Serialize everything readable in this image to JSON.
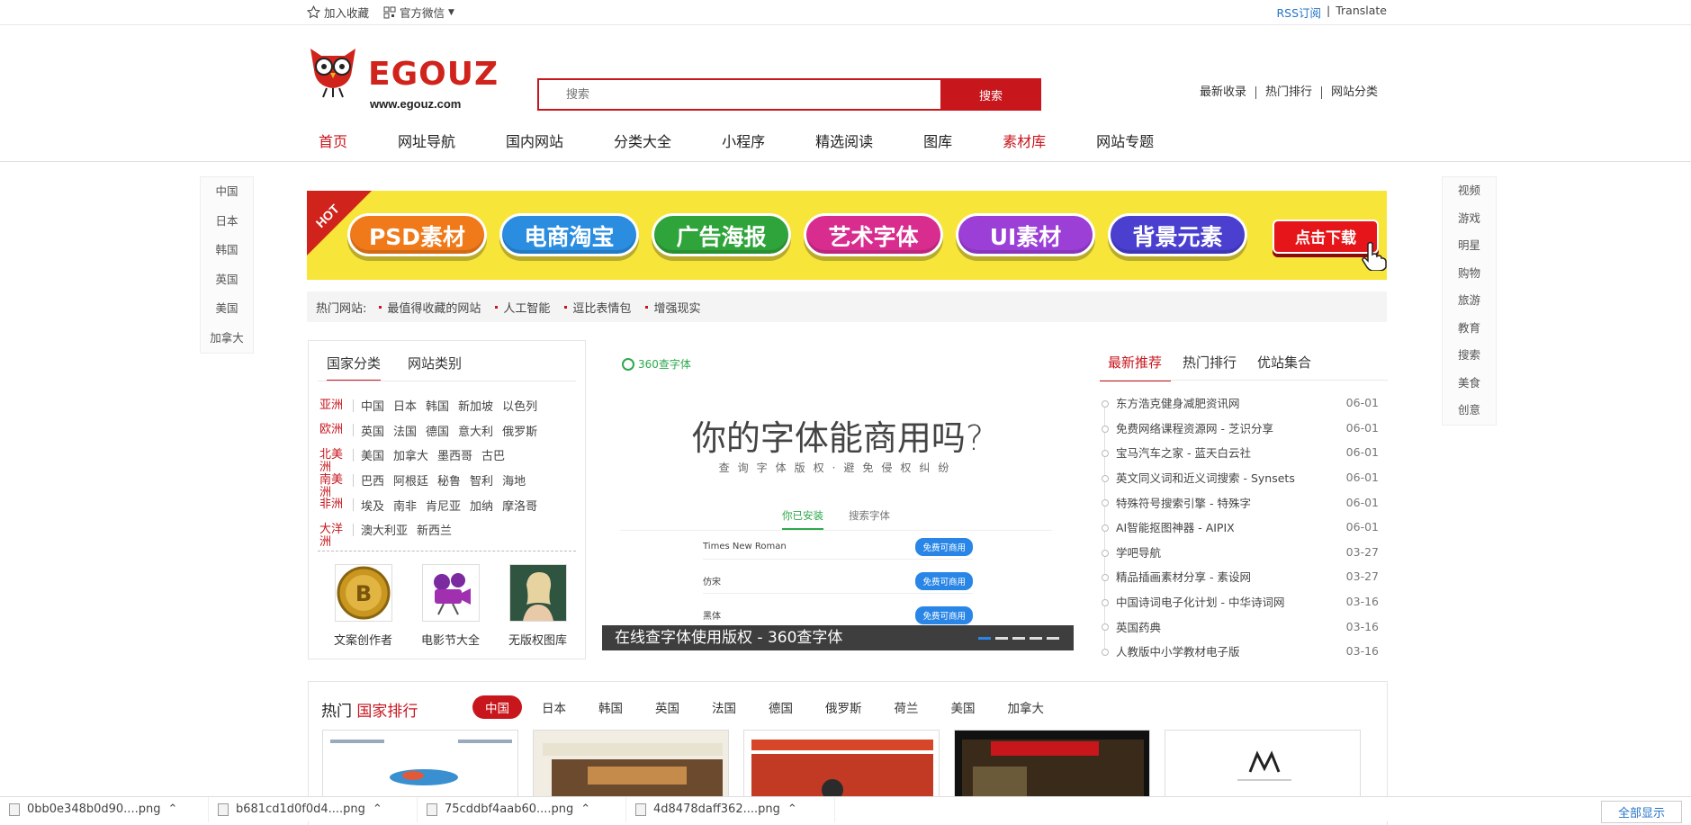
{
  "topbar": {
    "bookmark": "加入收藏",
    "wechat": "官方微信",
    "rss": "RSS订阅",
    "sep": "|",
    "translate": "Translate"
  },
  "logo": {
    "wordmark": "EGOUZ",
    "url": "www.egouz.com"
  },
  "search": {
    "placeholder": "搜索",
    "button": "搜索"
  },
  "header_links": [
    "最新收录",
    "热门排行",
    "网站分类"
  ],
  "nav": [
    "首页",
    "网址导航",
    "国内网站",
    "分类大全",
    "小程序",
    "精选阅读",
    "图库",
    "素材库",
    "网站专题"
  ],
  "side_left": [
    "中国",
    "日本",
    "韩国",
    "英国",
    "美国",
    "加拿大"
  ],
  "side_right": [
    "视频",
    "游戏",
    "明星",
    "购物",
    "旅游",
    "教育",
    "搜索",
    "美食",
    "创意"
  ],
  "banner": {
    "hot": "HOT",
    "pills": [
      {
        "label": "PSD素材",
        "color": "#f07a1a"
      },
      {
        "label": "电商淘宝",
        "color": "#2a8de0"
      },
      {
        "label": "广告海报",
        "color": "#2fa43a"
      },
      {
        "label": "艺术字体",
        "color": "#d82c8e"
      },
      {
        "label": "UI素材",
        "color": "#9b3fd6"
      },
      {
        "label": "背景元素",
        "color": "#4a3fcf"
      }
    ],
    "download": "点击下载"
  },
  "hot_sites": {
    "label": "热门网站:",
    "items": [
      "最值得收藏的网站",
      "人工智能",
      "逗比表情包",
      "增强现实"
    ]
  },
  "country_panel": {
    "tabs": [
      "国家分类",
      "网站类别"
    ],
    "regions": [
      {
        "name": "亚洲",
        "countries": [
          "中国",
          "日本",
          "韩国",
          "新加坡",
          "以色列"
        ]
      },
      {
        "name": "欧洲",
        "countries": [
          "英国",
          "法国",
          "德国",
          "意大利",
          "俄罗斯"
        ]
      },
      {
        "name": "北美洲",
        "countries": [
          "美国",
          "加拿大",
          "墨西哥",
          "古巴"
        ]
      },
      {
        "name": "南美洲",
        "countries": [
          "巴西",
          "阿根廷",
          "秘鲁",
          "智利",
          "海地"
        ]
      },
      {
        "name": "非洲",
        "countries": [
          "埃及",
          "南非",
          "肯尼亚",
          "加纳",
          "摩洛哥"
        ]
      },
      {
        "name": "大洋洲",
        "countries": [
          "澳大利亚",
          "新西兰"
        ]
      }
    ],
    "cards": [
      "文案创作者",
      "电影节大全",
      "无版权图库"
    ]
  },
  "slider": {
    "brand": "360查字体",
    "headline": "你的字体能商用吗?",
    "subline": "查询字体版权·避免侵权纠纷",
    "tabs": [
      "你已安装",
      "搜索字体"
    ],
    "fonts": [
      {
        "name": "Times New Roman",
        "tag": "免费可商用"
      },
      {
        "name": "仿宋",
        "tag": "免费可商用"
      },
      {
        "name": "黑体",
        "tag": "免费可商用"
      }
    ],
    "caption": "在线查字体使用版权 - 360查字体"
  },
  "news_panel": {
    "tabs": [
      "最新推荐",
      "热门排行",
      "优站集合"
    ],
    "items": [
      {
        "title": "东方浩克健身减肥资讯网",
        "date": "06-01"
      },
      {
        "title": "免费网络课程资源网 - 芝识分享",
        "date": "06-01"
      },
      {
        "title": "宝马汽车之家 - 蓝天白云社",
        "date": "06-01"
      },
      {
        "title": "英文同义词和近义词搜索 - Synsets",
        "date": "06-01"
      },
      {
        "title": "特殊符号搜索引擎 - 特殊字",
        "date": "06-01"
      },
      {
        "title": "AI智能抠图神器 - AIPIX",
        "date": "06-01"
      },
      {
        "title": "学吧导航",
        "date": "03-27"
      },
      {
        "title": "精品插画素材分享 - 素设网",
        "date": "03-27"
      },
      {
        "title": "中国诗词电子化计划 - 中华诗词网",
        "date": "03-16"
      },
      {
        "title": "英国药典",
        "date": "03-16"
      },
      {
        "title": "人教版中小学教材电子版",
        "date": "03-16"
      }
    ]
  },
  "ranking": {
    "title_a": "热门",
    "title_b": "国家排行",
    "tabs": [
      "中国",
      "日本",
      "韩国",
      "英国",
      "法国",
      "德国",
      "俄罗斯",
      "荷兰",
      "美国",
      "加拿大"
    ]
  },
  "downloads": [
    "0bb0e348b0d90....png",
    "b681cd1d0f0d4....png",
    "75cddbf4aab60....png",
    "4d8478daff362....png"
  ],
  "downloads_all": "全部显示"
}
